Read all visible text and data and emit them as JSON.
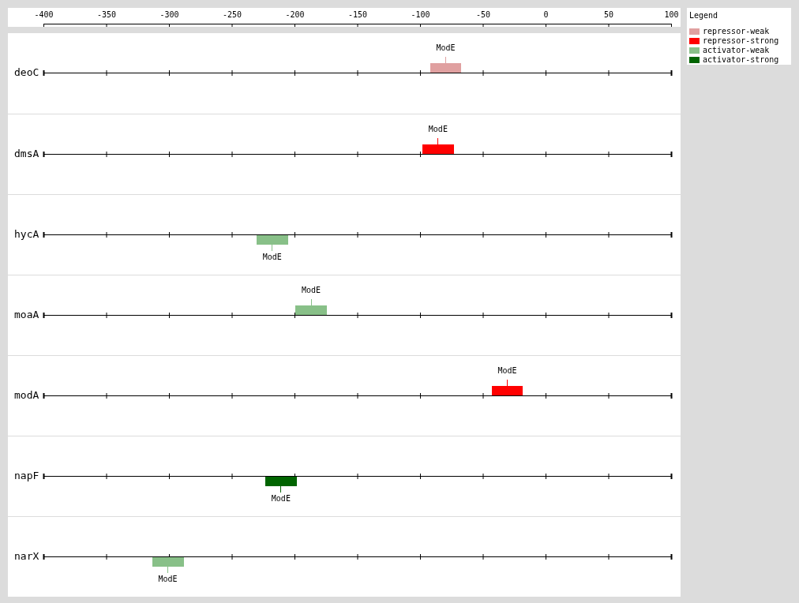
{
  "chart_data": {
    "type": "scatter",
    "orientation": "horizontal",
    "grid": true,
    "xlim": [
      -400,
      100
    ],
    "xticks": [
      -400,
      -350,
      -300,
      -250,
      -200,
      -150,
      -100,
      -50,
      0,
      50,
      100
    ],
    "categories": [
      "deoC",
      "dmsA",
      "hycA",
      "moaA",
      "modA",
      "napF",
      "narX"
    ],
    "series": [
      {
        "name": "repressor-weak",
        "color": "#e0a0a0",
        "values": [
          -80,
          null,
          null,
          null,
          null,
          null,
          null
        ]
      },
      {
        "name": "repressor-strong",
        "color": "#ff0000",
        "values": [
          null,
          -86,
          null,
          null,
          -31,
          null,
          null
        ]
      },
      {
        "name": "activator-weak",
        "color": "#88c088",
        "values": [
          null,
          null,
          -218,
          -187,
          null,
          null,
          -301
        ]
      },
      {
        "name": "activator-strong",
        "color": "#006400",
        "values": [
          null,
          null,
          null,
          null,
          null,
          -211,
          null
        ]
      }
    ]
  },
  "site_labels": [
    {
      "label": "ModE",
      "above": true
    },
    {
      "label": "ModE",
      "above": true
    },
    {
      "label": "ModE",
      "above": false
    },
    {
      "label": "ModE",
      "above": true
    },
    {
      "label": "ModE",
      "above": true
    },
    {
      "label": "ModE",
      "above": false
    },
    {
      "label": "ModE",
      "above": false
    }
  ],
  "legend": {
    "title": "Legend"
  }
}
